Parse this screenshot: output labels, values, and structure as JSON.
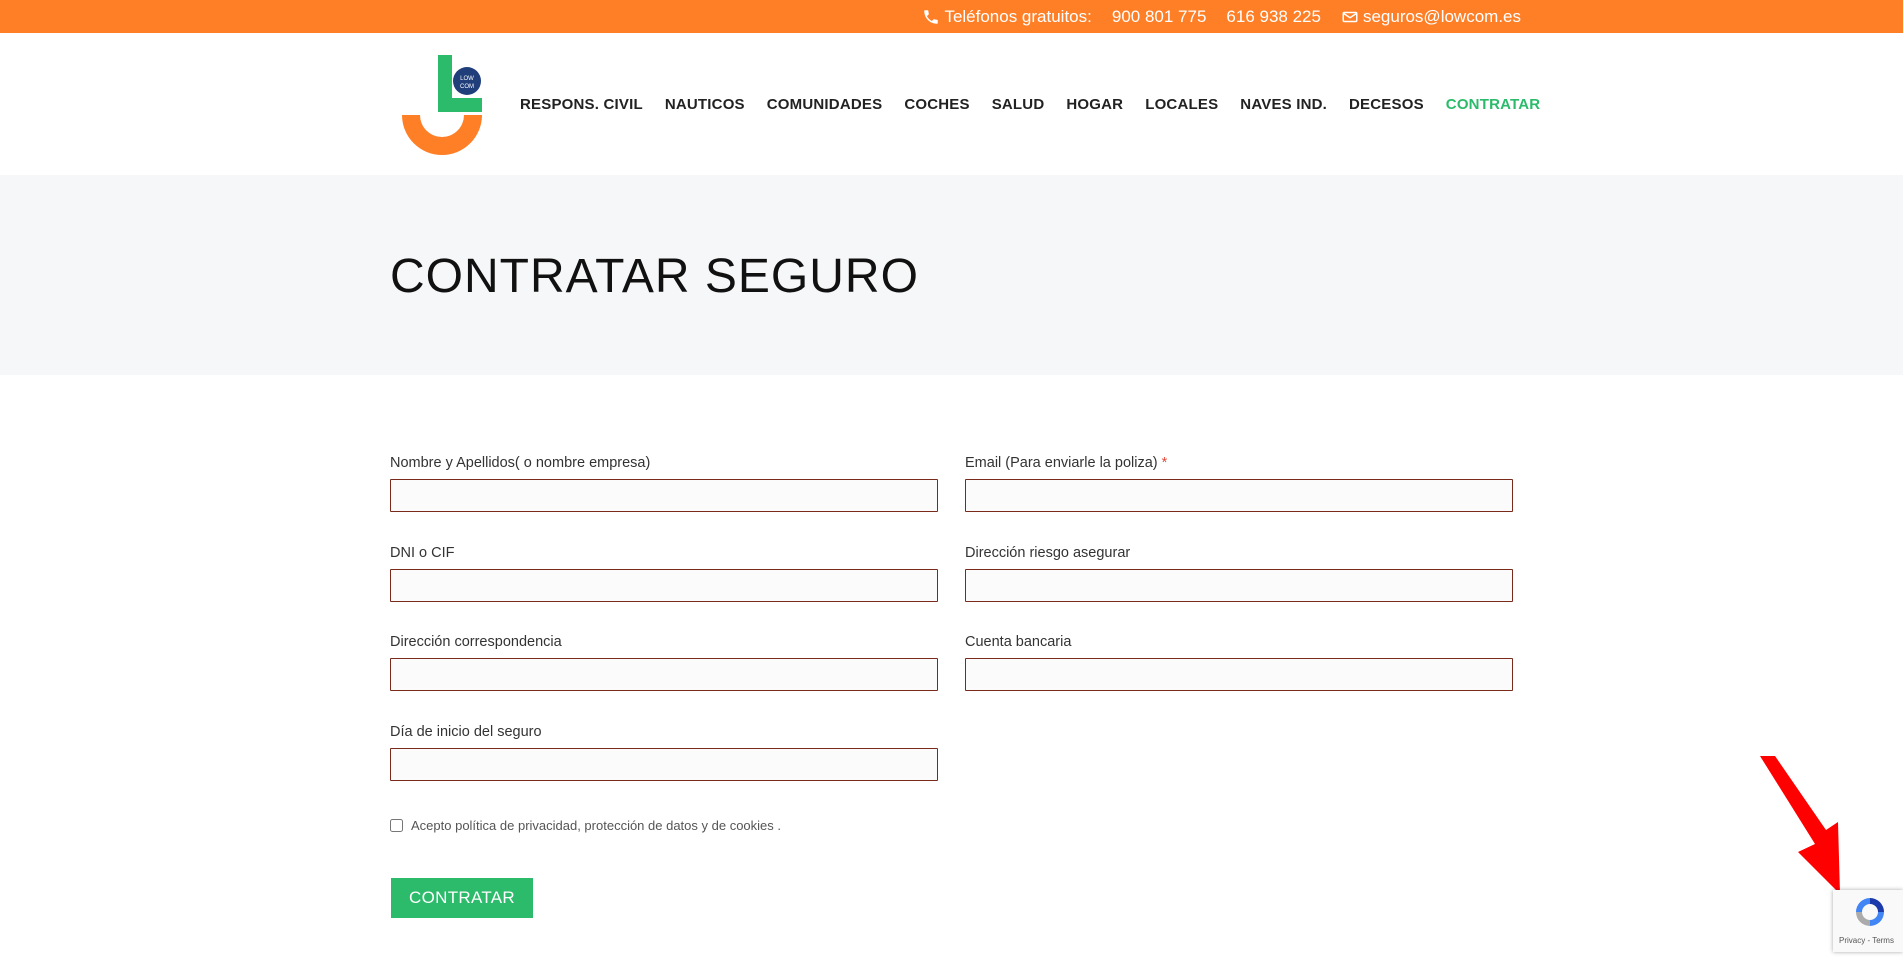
{
  "topbar": {
    "phones_label": "Teléfonos gratuitos:",
    "phone1": "900 801 775",
    "phone2": "616 938 225",
    "email": "seguros@lowcom.es"
  },
  "logo": {
    "text_line1": "LOW",
    "text_line2": "COM"
  },
  "nav": {
    "items": [
      {
        "label": "RESPONS. CIVIL"
      },
      {
        "label": "NAUTICOS"
      },
      {
        "label": "COMUNIDADES"
      },
      {
        "label": "COCHES"
      },
      {
        "label": "SALUD"
      },
      {
        "label": "HOGAR"
      },
      {
        "label": "LOCALES"
      },
      {
        "label": "NAVES IND."
      },
      {
        "label": "DECESOS"
      },
      {
        "label": "CONTRATAR",
        "active": true
      }
    ]
  },
  "page": {
    "title": "CONTRATAR SEGURO"
  },
  "form": {
    "name_label": "Nombre y Apellidos( o nombre empresa)",
    "name_value": "",
    "email_label": "Email (Para enviarle la poliza)",
    "email_required_mark": "*",
    "email_value": "",
    "dni_label": "DNI o CIF",
    "dni_value": "",
    "risk_address_label": "Dirección riesgo asegurar",
    "risk_address_value": "",
    "mail_address_label": "Dirección correspondencia",
    "mail_address_value": "",
    "bank_account_label": "Cuenta bancaria",
    "bank_account_value": "",
    "start_date_label": "Día de inicio del seguro",
    "start_date_value": "",
    "consent_label": "Acepto política de privacidad, protección de datos y de cookies .",
    "consent_checked": false,
    "submit_label": "CONTRATAR"
  },
  "recaptcha": {
    "links": "Privacy - Terms"
  },
  "colors": {
    "topbar": "#ff7f27",
    "accent_green": "#2bbb6a",
    "hero_bg": "#f6f7f9",
    "arrow": "#ff0000"
  }
}
